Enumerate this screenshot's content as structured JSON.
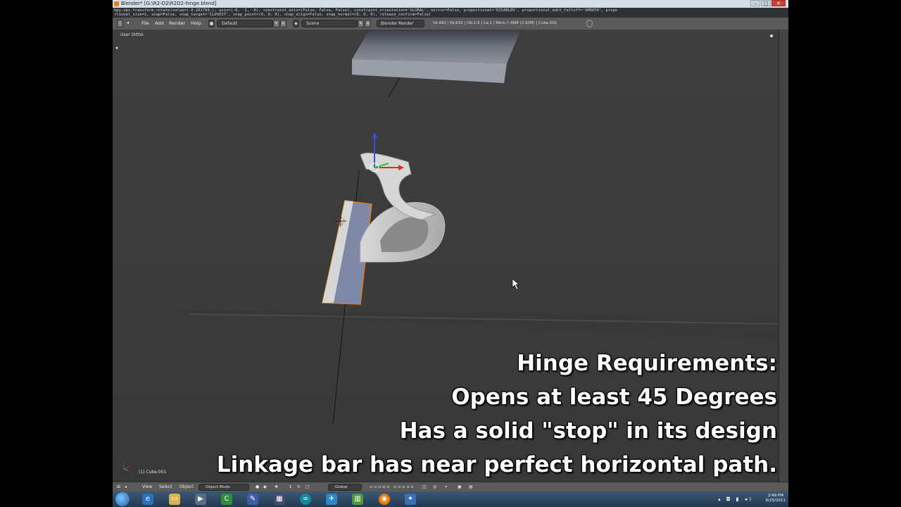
{
  "window": {
    "title": "Blender* [G:\\R2-D2\\R2D2-hinge.blend]",
    "controls": [
      "–",
      "□",
      "✕"
    ]
  },
  "info_lines": [
    "bpy.ops.transform.rotate(value=(-0.261799,), axis=(-0, -1, -0), constraint_axis=(False, False, False), constraint_orientation='GLOBAL', mirror=False, proportional='DISABLED', proportional_edit_falloff='SMOOTH', propo",
    "rtional_size=1, snap=False, snap_target='CLOSEST', snap_point=(0, 0, 0), snap_align=False, snap_normal=(0, 0, 0), release_confirm=False)"
  ],
  "header": {
    "menus": [
      "File",
      "Add",
      "Render",
      "Help"
    ],
    "screen_layout": "Default",
    "scene": "Scene",
    "render_engine": "Blender Render",
    "stats": "Ve:682 | Fa:632 | Ob:1-6 | La:1 | Mem:7.46M (3.92M) | Cube.001"
  },
  "viewport": {
    "view_label": "User Ortho",
    "object_label": "(1) Cube.001"
  },
  "captions": [
    "Hinge Requirements:",
    "Opens at least 45 Degrees",
    "Has a solid \"stop\" in its design",
    "Linkage bar has near perfect horizontal path."
  ],
  "footer": {
    "items": [
      "View",
      "Select",
      "Object"
    ],
    "mode": "Object Mode",
    "orientation": "Global"
  },
  "taskbar": {
    "time": "2:49 PM",
    "date": "6/25/2011"
  },
  "colors": {
    "blender_orange": "#e87d0d",
    "viewport_bg": "#3d3d3d",
    "header_bg": "#5a5a5a"
  }
}
